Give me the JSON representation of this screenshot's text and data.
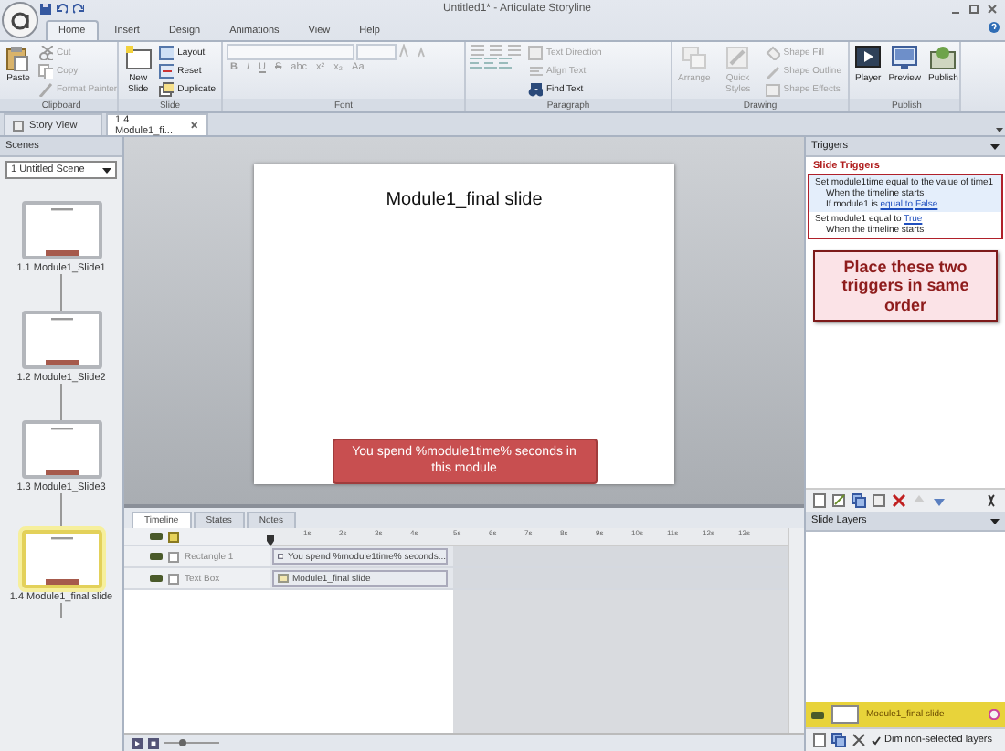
{
  "window": {
    "title": "Untitled1* - Articulate Storyline"
  },
  "ribbon": {
    "tabs": [
      {
        "label": "Home",
        "selected": true
      },
      {
        "label": "Insert",
        "selected": false
      },
      {
        "label": "Design",
        "selected": false
      },
      {
        "label": "Animations",
        "selected": false
      },
      {
        "label": "View",
        "selected": false
      },
      {
        "label": "Help",
        "selected": false
      }
    ],
    "groups": [
      {
        "label": "Clipboard",
        "items": [
          {
            "label": "Paste",
            "kind": "large",
            "disabled": false
          },
          {
            "label": "Cut",
            "kind": "small",
            "disabled": true
          },
          {
            "label": "Copy",
            "kind": "small",
            "disabled": true
          },
          {
            "label": "Format Painter",
            "kind": "small",
            "disabled": true
          }
        ]
      },
      {
        "label": "Slide",
        "items": [
          {
            "label": "New Slide",
            "kind": "large",
            "disabled": false
          },
          {
            "label": "Layout",
            "kind": "small",
            "disabled": false
          },
          {
            "label": "Reset",
            "kind": "small",
            "disabled": false
          },
          {
            "label": "Duplicate",
            "kind": "small",
            "disabled": false
          }
        ]
      },
      {
        "label": "Font",
        "items": [
          {
            "label": "B",
            "kind": "key",
            "disabled": true
          },
          {
            "label": "I",
            "kind": "key",
            "disabled": true
          },
          {
            "label": "U",
            "kind": "key",
            "disabled": true
          },
          {
            "label": "S",
            "kind": "key",
            "disabled": true
          },
          {
            "label": "abc",
            "kind": "key",
            "disabled": true
          },
          {
            "label": "x²",
            "kind": "key",
            "disabled": true
          },
          {
            "label": "x₂",
            "kind": "key",
            "disabled": true
          },
          {
            "label": "Aa",
            "kind": "key",
            "disabled": true
          }
        ]
      },
      {
        "label": "Paragraph",
        "items": [
          {
            "label": "Text Direction",
            "kind": "small",
            "disabled": true
          },
          {
            "label": "Align Text",
            "kind": "small",
            "disabled": true
          },
          {
            "label": "Find Text",
            "kind": "small",
            "disabled": false
          }
        ]
      },
      {
        "label": "Drawing",
        "items": [
          {
            "label": "Arrange",
            "kind": "large",
            "disabled": true
          },
          {
            "label": "Quick Styles",
            "kind": "large",
            "disabled": true
          },
          {
            "label": "Shape Fill",
            "kind": "small",
            "disabled": true
          },
          {
            "label": "Shape Outline",
            "kind": "small",
            "disabled": true
          },
          {
            "label": "Shape Effects",
            "kind": "small",
            "disabled": true
          }
        ]
      },
      {
        "label": "Publish",
        "items": [
          {
            "label": "Player",
            "kind": "large",
            "disabled": false
          },
          {
            "label": "Preview",
            "kind": "large",
            "disabled": false
          },
          {
            "label": "Publish",
            "kind": "large",
            "disabled": false
          }
        ]
      }
    ]
  },
  "document_tabs": [
    {
      "label": "Story View",
      "selected": false
    },
    {
      "label": "1.4 Module1_fi...",
      "selected": true
    }
  ],
  "scenes": {
    "title": "Scenes",
    "scene": "1 Untitled Scene",
    "slides": [
      {
        "label": "1.1 Module1_Slide1",
        "selected": false
      },
      {
        "label": "1.2 Module1_Slide2",
        "selected": false
      },
      {
        "label": "1.3 Module1_Slide3",
        "selected": false
      },
      {
        "label": "1.4 Module1_final slide",
        "selected": true
      }
    ]
  },
  "slide": {
    "title": "Module1_final slide",
    "button": "You spend %module1time% seconds in this module"
  },
  "timeline": {
    "tabs": [
      {
        "label": "Timeline",
        "selected": true
      },
      {
        "label": "States",
        "selected": false
      },
      {
        "label": "Notes",
        "selected": false
      }
    ],
    "ticks": [
      "1s",
      "2s",
      "3s",
      "4s",
      "5s",
      "6s",
      "7s",
      "8s",
      "9s",
      "10s",
      "11s",
      "12s",
      "13s"
    ],
    "rows": [
      {
        "name": "Rectangle 1",
        "bar": "You spend %module1time% seconds..."
      },
      {
        "name": "Text Box",
        "bar": "Module1_final slide"
      }
    ]
  },
  "triggers": {
    "title": "Triggers",
    "section": "Slide Triggers",
    "items": [
      {
        "selected": true,
        "lines": [
          [
            {
              "text": "Set module1time equal to the value of time1",
              "link": false
            }
          ],
          [
            {
              "text": "When the timeline starts",
              "link": false
            }
          ],
          [
            {
              "text": "If module1 is",
              "link": false
            },
            {
              "text": "equal to",
              "link": true
            },
            {
              "text": "False",
              "link": true
            }
          ]
        ]
      },
      {
        "selected": false,
        "lines": [
          [
            {
              "text": "Set module1 equal to",
              "link": false
            },
            {
              "text": "True",
              "link": true
            }
          ],
          [
            {
              "text": "When the timeline starts",
              "link": false
            }
          ]
        ]
      }
    ],
    "callout": "Place these two triggers in same order"
  },
  "layers": {
    "title": "Slide Layers",
    "items": [
      {
        "name": "Module1_final slide",
        "selected": true
      }
    ],
    "dim": {
      "label": "Dim non-selected layers",
      "checked": true
    }
  }
}
